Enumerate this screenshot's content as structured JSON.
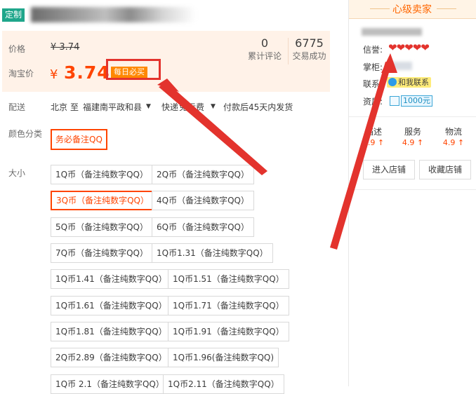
{
  "title_tag": "定制",
  "price": {
    "label_price": "价格",
    "old_price": "¥ 3.74",
    "label_taobao": "淘宝价",
    "currency": "¥",
    "new_price": "3.74",
    "daily_badge": "每日必买",
    "reviews_count": "0",
    "reviews_label": "累计评论",
    "trades_count": "6775",
    "trades_label": "交易成功"
  },
  "shipping": {
    "label": "配送",
    "from": "北京",
    "to_word": "至",
    "destination": "福建南平政和县",
    "express": "快递",
    "free_shipping": "免运费",
    "delivery": "付款后45天内发货"
  },
  "color": {
    "label": "颜色分类",
    "option": "务必备注QQ"
  },
  "size": {
    "label": "大小",
    "options": [
      "1Q币（备注纯数字QQ）",
      "2Q币（备注纯数字QQ）",
      "3Q币（备注纯数字QQ）",
      "4Q币（备注纯数字QQ）",
      "5Q币（备注纯数字QQ）",
      "6Q币（备注纯数字QQ）",
      "7Q币（备注纯数字QQ）",
      "1Q币1.31（备注纯数字QQ）",
      "1Q币1.41（备注纯数字QQ）",
      "1Q币1.51（备注纯数字QQ）",
      "1Q币1.61（备注纯数字QQ）",
      "1Q币1.71（备注纯数字QQ）",
      "1Q币1.81（备注纯数字QQ）",
      "1Q币1.91（备注纯数字QQ）",
      "2Q币2.89（备注纯数字QQ）",
      "1Q币1.96(备注纯数字QQ)",
      "1Q币 2.1（备注纯数字QQ）",
      "1Q币2.11（备注纯数字QQ）"
    ],
    "selected": "3Q币（备注纯数字QQ）"
  },
  "seller": {
    "header": "心级卖家",
    "credit_label": "信誉:",
    "hearts": "❤❤❤❤❤",
    "keeper_label": "掌柜:",
    "contact_label": "联系:",
    "contact_badge": "和我联系",
    "quality_label": "资质:",
    "deposit_badge": "1000元",
    "scores": [
      {
        "label": "描述",
        "value": "4.9 ↑"
      },
      {
        "label": "服务",
        "value": "4.9 ↑"
      },
      {
        "label": "物流",
        "value": "4.9 ↑"
      }
    ],
    "enter_shop": "进入店铺",
    "favorite_shop": "收藏店铺"
  },
  "colors": {
    "accent": "#ff4400",
    "annotation_red": "#e3332d",
    "price_bg": "#fff2e8",
    "tag_green": "#1fa68b"
  }
}
